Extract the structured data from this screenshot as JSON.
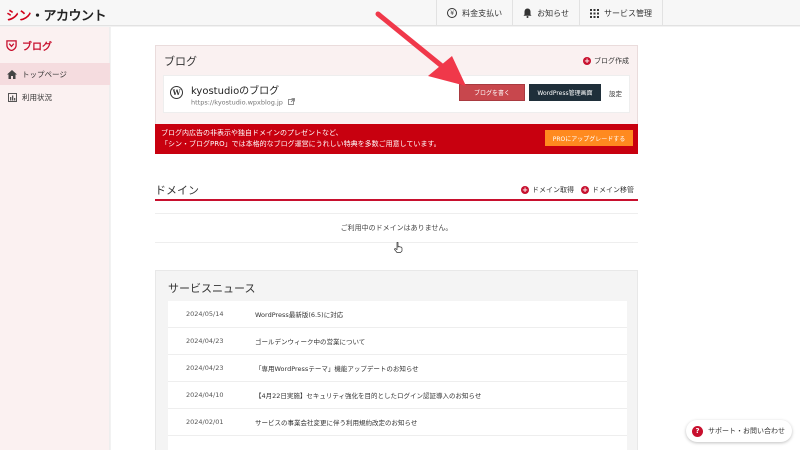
{
  "header": {
    "logo_part1": "シン",
    "logo_part2": "・アカウント",
    "nav": [
      {
        "label": "料金支払い",
        "icon": "yen-icon"
      },
      {
        "label": "お知らせ",
        "icon": "bell-icon"
      },
      {
        "label": "サービス管理",
        "icon": "grid-icon"
      }
    ]
  },
  "sidebar": {
    "title": "ブログ",
    "items": [
      {
        "label": "トップページ",
        "icon": "home-icon",
        "active": true
      },
      {
        "label": "利用状況",
        "icon": "usage-icon",
        "active": false
      }
    ]
  },
  "blog": {
    "heading": "ブログ",
    "create_label": "ブログ作成",
    "name": "kyostudioのブログ",
    "url": "https://kyostudio.wpxblog.jp",
    "write_button": "ブログを書く",
    "wp_admin_button": "WordPress管理画面",
    "settings_label": "設定"
  },
  "promo": {
    "line1": "ブログ内広告の非表示や独自ドメインのプレゼントなど、",
    "line2": "「シン・ブログPRO」では本格的なブログ運営にうれしい特典を多数ご用意しています。",
    "button": "PROにアップグレードする"
  },
  "domain": {
    "heading": "ドメイン",
    "acquire_label": "ドメイン取得",
    "transfer_label": "ドメイン移管",
    "empty_message": "ご利用中のドメインはありません。"
  },
  "news": {
    "heading": "サービスニュース",
    "items": [
      {
        "date": "2024/05/14",
        "title": "WordPress最新版(6.5)に対応"
      },
      {
        "date": "2024/04/23",
        "title": "ゴールデンウィーク中の営業について"
      },
      {
        "date": "2024/04/23",
        "title": "「専用WordPressテーマ」機能アップデートのお知らせ"
      },
      {
        "date": "2024/04/10",
        "title": "【4月22日実施】セキュリティ強化を目的としたログイン認証導入のお知らせ"
      },
      {
        "date": "2024/02/01",
        "title": "サービスの事業会社変更に伴う利用規約改定のお知らせ"
      }
    ]
  },
  "support": {
    "label": "サポート・お問い合わせ"
  },
  "colors": {
    "brand_red": "#c8102e",
    "promo_red": "#c8000f",
    "write_button": "#c8474d",
    "wp_admin_button": "#1f2f3a",
    "upgrade_button": "#ff8a1f",
    "annotation_arrow": "#f0384a"
  }
}
